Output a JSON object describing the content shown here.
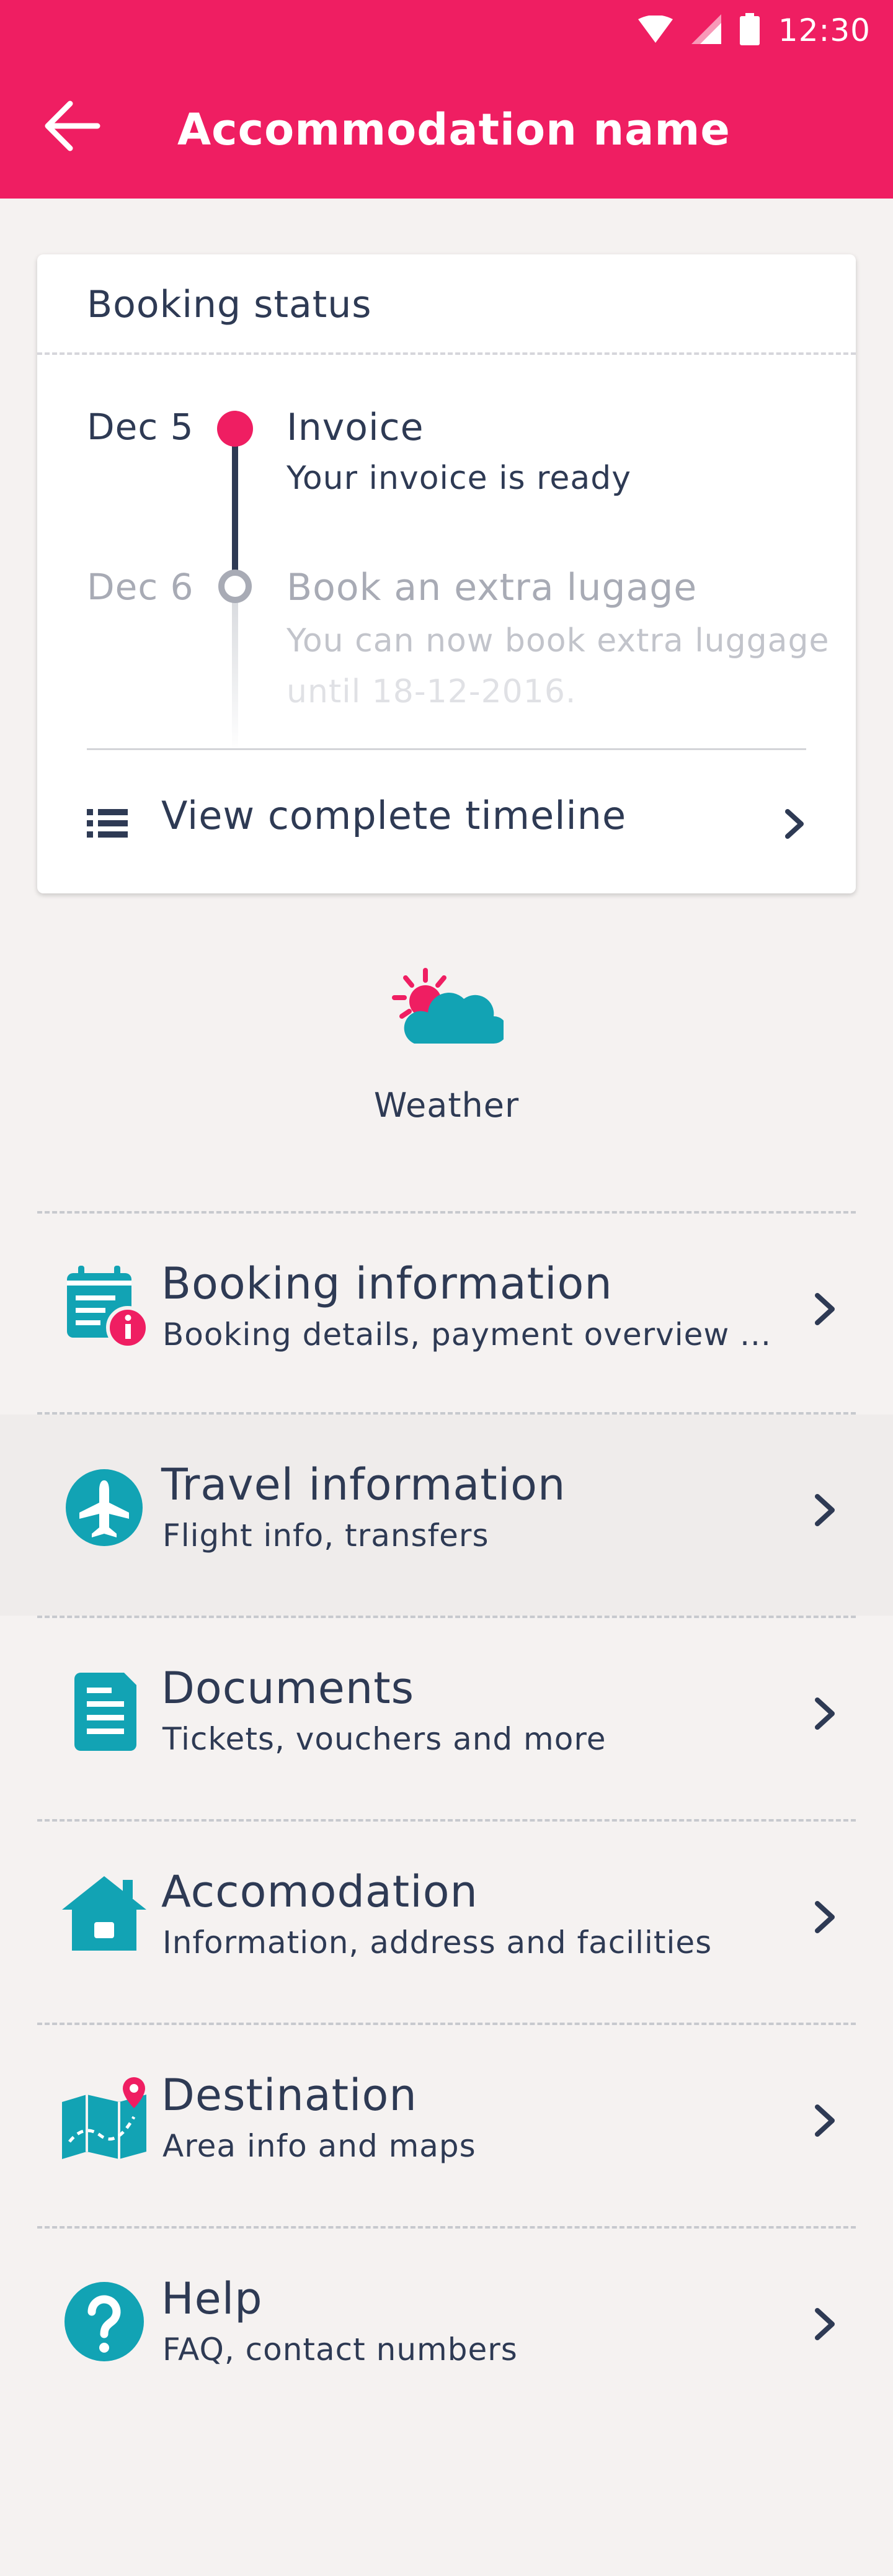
{
  "status_bar": {
    "time": "12:30"
  },
  "app_bar": {
    "title": "Accommodation name"
  },
  "booking_status": {
    "title": "Booking status",
    "events": [
      {
        "date": "Dec 5",
        "title": "Invoice",
        "description": "Your invoice is ready"
      },
      {
        "date": "Dec 6",
        "title": "Book an extra lugage",
        "description_line1": "You can now book extra luggage",
        "description_line2": "until 18-12-2016."
      }
    ],
    "view_timeline_label": "View complete timeline"
  },
  "weather": {
    "label": "Weather"
  },
  "menu": {
    "items": [
      {
        "title": "Booking information",
        "subtitle": "Booking details, payment overview ...",
        "icon": "calendar-info-icon"
      },
      {
        "title": "Travel information",
        "subtitle": "Flight info, transfers",
        "icon": "airplane-icon"
      },
      {
        "title": "Documents",
        "subtitle": "Tickets, vouchers and more",
        "icon": "document-icon"
      },
      {
        "title": "Accomodation",
        "subtitle": "Information, address and facilities",
        "icon": "house-icon"
      },
      {
        "title": "Destination",
        "subtitle": "Area info and maps",
        "icon": "map-pin-icon"
      },
      {
        "title": "Help",
        "subtitle": "FAQ, contact numbers",
        "icon": "help-icon"
      }
    ]
  },
  "colors": {
    "brand": "#ef1e62",
    "text": "#2e3a54",
    "accent": "#12a3b4",
    "muted": "#a8abb5",
    "background": "#f5f2f1"
  }
}
